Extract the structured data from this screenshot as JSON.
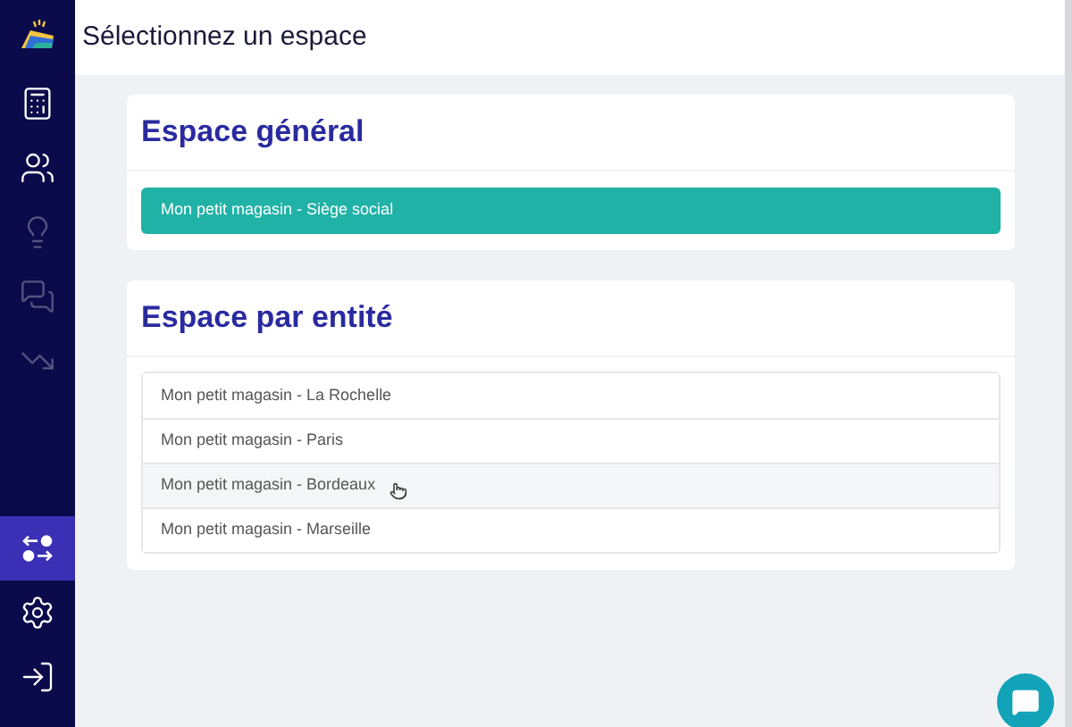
{
  "sidebar": {
    "top_items": [
      {
        "kind": "calculator",
        "selected": false,
        "disabled": false
      },
      {
        "kind": "people",
        "selected": false,
        "disabled": false
      },
      {
        "kind": "idea",
        "selected": false,
        "disabled": true
      },
      {
        "kind": "chat",
        "selected": false,
        "disabled": true
      },
      {
        "kind": "chart",
        "selected": false,
        "disabled": true
      }
    ],
    "bottom_items": [
      {
        "kind": "switch",
        "selected": true,
        "disabled": false
      },
      {
        "kind": "settings",
        "selected": false,
        "disabled": false
      },
      {
        "kind": "logout",
        "selected": false,
        "disabled": false
      }
    ]
  },
  "header": {
    "title": "Sélectionnez un espace"
  },
  "general": {
    "title": "Espace général",
    "button": "Mon petit magasin - Siège social"
  },
  "entities": {
    "title": "Espace par entité",
    "items": [
      {
        "label": "Mon petit magasin - La Rochelle",
        "hovered": false
      },
      {
        "label": "Mon petit magasin - Paris",
        "hovered": false
      },
      {
        "label": "Mon petit magasin - Bordeaux",
        "hovered": true
      },
      {
        "label": "Mon petit magasin - Marseille",
        "hovered": false
      }
    ]
  }
}
